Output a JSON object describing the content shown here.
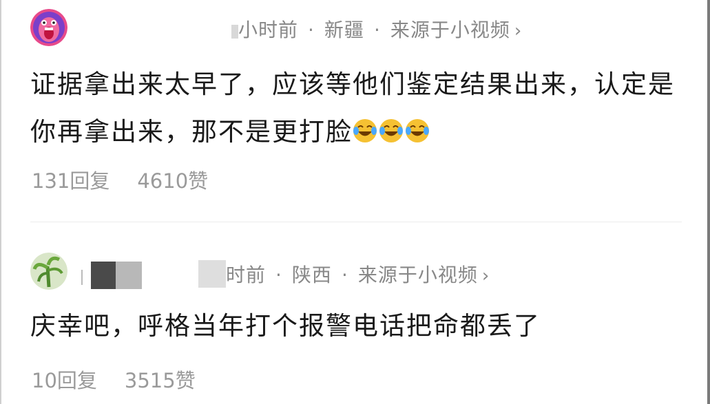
{
  "comments": [
    {
      "meta_time": "小时前",
      "meta_location": "新疆",
      "meta_source": "来源于小视频",
      "text": "证据拿出来太早了，应该等他们鉴定结果出来，认定是你再拿出来，那不是更打脸",
      "emoji_count": 3,
      "emoji_name": "laughing-crying",
      "replies": "131回复",
      "likes": "4610赞"
    },
    {
      "meta_time": "时前",
      "meta_location": "陕西",
      "meta_source": "来源于小视频",
      "text": "庆幸吧，呼格当年打个报警电话把命都丢了",
      "replies": "10回复",
      "likes": "3515赞"
    }
  ],
  "separator": "·",
  "chevron": "›",
  "colors": {
    "meta": "#888888",
    "text": "#1a1a1a",
    "stats": "#9a9a9a",
    "avatar1_bg": "#e84a8a",
    "emoji_yellow": "#f5c133"
  }
}
